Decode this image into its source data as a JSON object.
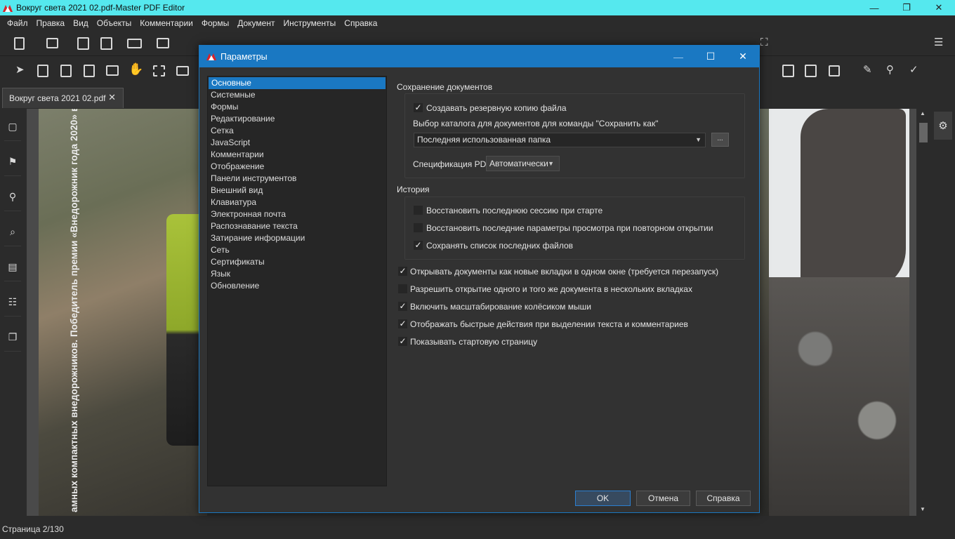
{
  "window": {
    "title": "Вокруг света 2021 02.pdf-Master PDF Editor",
    "controls": [
      "—",
      "❐",
      "✕"
    ]
  },
  "menu": [
    "Файл",
    "Правка",
    "Вид",
    "Объекты",
    "Комментарии",
    "Формы",
    "Документ",
    "Инструменты",
    "Справка"
  ],
  "document_tab": {
    "label": "Вокруг света 2021 02.pdf",
    "close": "✕"
  },
  "page": {
    "caption": "амных компактных внедорожников. Победитель премии «Внедорожник года 2020» в"
  },
  "statusbar": {
    "page_info": "Страница 2/130"
  },
  "dialog": {
    "title": "Параметры",
    "controls": [
      "—",
      "☐",
      "✕"
    ],
    "categories": [
      "Основные",
      "Системные",
      "Формы",
      "Редактирование",
      "Сетка",
      "JavaScript",
      "Комментарии",
      "Отображение",
      "Панели инструментов",
      "Внешний вид",
      "Клавиатура",
      "Электронная почта",
      "Распознавание текста",
      "Затирание информации",
      "Сеть",
      "Сертификаты",
      "Язык",
      "Обновление"
    ],
    "selected_category": "Основные",
    "save_group": {
      "title": "Сохранение документов",
      "backup_label": "Создавать резервную копию файла",
      "backup_checked": true,
      "catalog_label": "Выбор каталога для документов для команды \"Сохранить как\"",
      "catalog_value": "Последняя использованная папка",
      "browse_label": "...",
      "pdfspec_label": "Спецификация PDF",
      "pdfspec_value": "Автоматически"
    },
    "history_group": {
      "title": "История",
      "options": [
        {
          "label": "Восстановить последнюю сессию при старте",
          "checked": false
        },
        {
          "label": "Восстановить последние параметры просмотра при повторном открытии",
          "checked": false
        },
        {
          "label": "Сохранять список последних файлов",
          "checked": true
        }
      ]
    },
    "general_options": [
      {
        "label": "Открывать документы как новые вкладки в одном окне (требуется перезапуск)",
        "checked": true
      },
      {
        "label": "Разрешить открытие одного и того же документа в нескольких вкладках",
        "checked": false
      },
      {
        "label": "Включить масштабирование колёсиком мыши",
        "checked": true
      },
      {
        "label": "Отображать быстрые действия при выделении текста и комментариев",
        "checked": true
      },
      {
        "label": "Показывать стартовую страницу",
        "checked": true
      }
    ],
    "buttons": {
      "ok": "OK",
      "cancel": "Отмена",
      "help": "Справка"
    }
  },
  "colors": {
    "accent": "#1a78c2",
    "titlebar": "#55e8ee",
    "background": "#2b2b2b",
    "dialog": "#323232"
  }
}
